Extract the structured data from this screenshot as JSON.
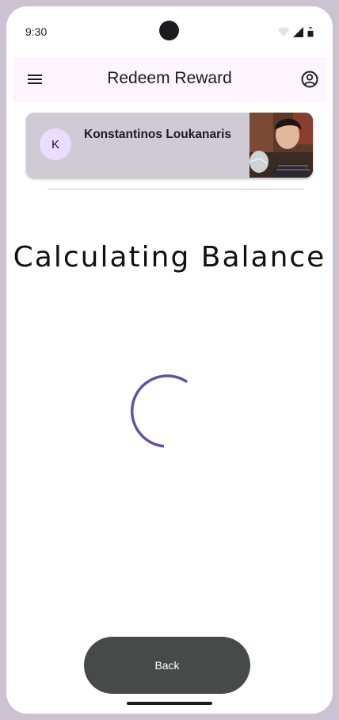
{
  "status_bar": {
    "time": "9:30",
    "wifi_icon": "wifi-icon",
    "signal_icon": "signal-icon",
    "battery_icon": "battery-icon"
  },
  "app_bar": {
    "title": "Redeem Reward",
    "menu_icon": "menu-icon",
    "account_icon": "account-circle-icon"
  },
  "card": {
    "avatar_initial": "K",
    "name": "Konstantinos Loukanaris",
    "photo": "profile-photo"
  },
  "main": {
    "heading": "Calculating Balance",
    "loading": "progress-spinner"
  },
  "footer": {
    "back_label": "Back"
  },
  "colors": {
    "app_bar_bg": "#fcf5fd",
    "card_bg": "#d0cad4",
    "avatar_bg": "#eaddff",
    "spinner": "#6750a4",
    "button_bg": "#464a49",
    "frame": "#cbc2d2"
  }
}
